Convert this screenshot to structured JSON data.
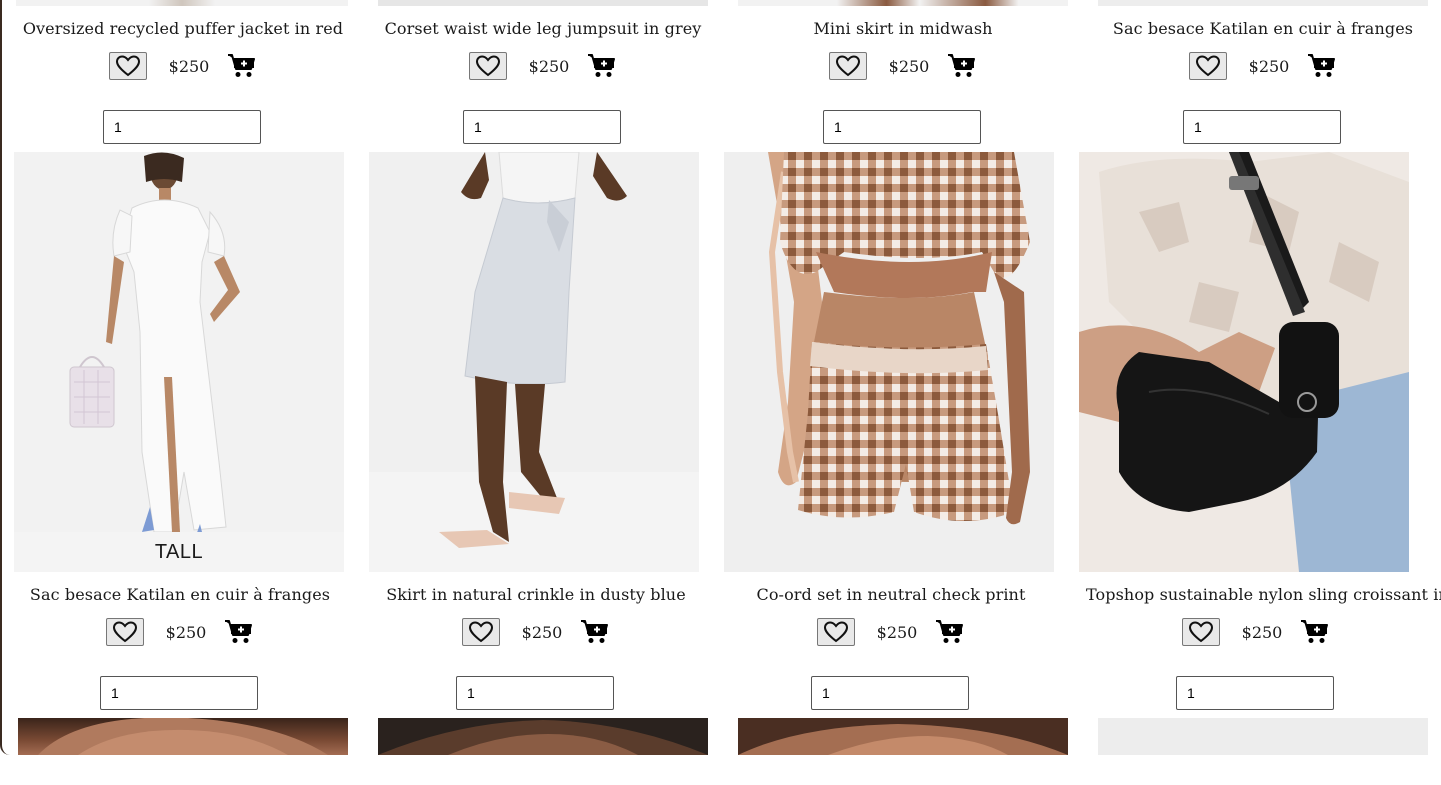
{
  "products_row1": [
    {
      "title": "Oversized recycled puffer jacket in red",
      "price": "$250",
      "qty": "1"
    },
    {
      "title": "Corset waist wide leg jumpsuit in grey",
      "price": "$250",
      "qty": "1"
    },
    {
      "title": "Mini skirt in midwash",
      "price": "$250",
      "qty": "1"
    },
    {
      "title": "Sac besace Katilan en cuir à franges",
      "price": "$250",
      "qty": "1"
    }
  ],
  "products_row2": [
    {
      "title": "Sac besace Katilan en cuir à franges",
      "price": "$250",
      "qty": "1",
      "image_badge": "TALL",
      "image": "white-dress-icon"
    },
    {
      "title": "Skirt in natural crinkle in dusty blue",
      "price": "$250",
      "qty": "1",
      "image": "wrap-skirt-icon"
    },
    {
      "title": "Co-ord set in neutral check print",
      "price": "$250",
      "qty": "1",
      "image": "gingham-set-icon"
    },
    {
      "title": "Topshop sustainable nylon sling croissant in black",
      "price": "$250",
      "qty": "1",
      "image": "sling-bag-icon"
    }
  ],
  "icons": {
    "favorite": "heart-icon",
    "cart": "add-to-cart-icon"
  },
  "colors": {
    "button_bg": "#e9e9e9",
    "text": "#1a1a1a",
    "image_bg": "#f0f0f0"
  }
}
